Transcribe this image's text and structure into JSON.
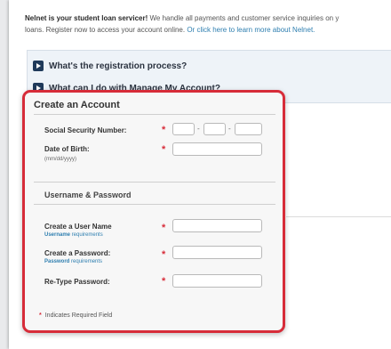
{
  "intro": {
    "bold": "Nelnet is your student loan servicer!",
    "line1_rest": " We handle all payments and customer service inquiries on y",
    "line2_prefix": "loans. Register now to access your account online. ",
    "link": "Or click here to learn more about Nelnet."
  },
  "faq": {
    "items": [
      "What's the registration process?",
      "What can I do with Manage My Account?"
    ]
  },
  "form": {
    "title": "Create an Account",
    "ssn_label": "Social Security Number:",
    "ssn_separator": "-",
    "dob_label": "Date of Birth:",
    "dob_hint": "(mm/dd/yyyy)",
    "section_title": "Username & Password",
    "username_label": "Create a User Name",
    "username_req_bold": "Username",
    "username_req_rest": " requirements",
    "password_label": "Create a Password:",
    "password_req_bold": "Password",
    "password_req_rest": " requirements",
    "retype_label": "Re-Type Password:",
    "required_star": "*",
    "required_note": "Indicates Required Field"
  },
  "colors": {
    "accent_red": "#d72c39",
    "link_blue": "#2f7fb0",
    "faq_bg": "#eef3f8"
  },
  "icons": [
    "play-icon"
  ]
}
